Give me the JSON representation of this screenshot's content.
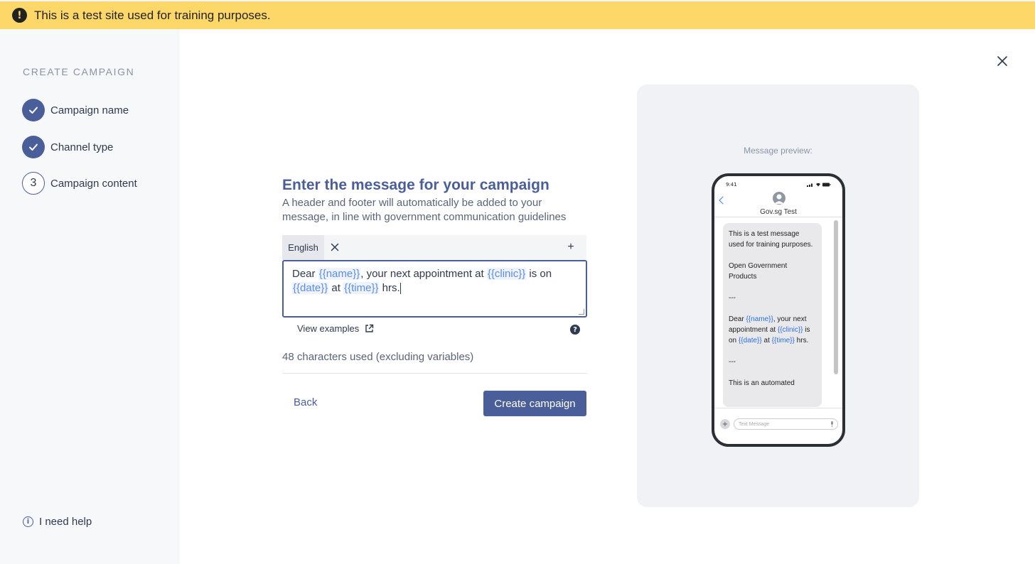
{
  "banner": {
    "text": "This is a test site used for training purposes.",
    "icon": "!"
  },
  "sidebar": {
    "title": "CREATE CAMPAIGN",
    "steps": [
      {
        "label": "Campaign name",
        "status": "done"
      },
      {
        "label": "Channel type",
        "status": "done"
      },
      {
        "label": "Campaign content",
        "status": "current",
        "number": "3"
      }
    ],
    "help_label": "I need help",
    "help_icon": "i"
  },
  "main": {
    "heading": "Enter the message for your campaign",
    "subtext": "A header and footer will automatically be added to your message, in line with government communication guidelines",
    "tabs": [
      {
        "label": "English",
        "active": true
      }
    ],
    "add_tab": "+",
    "message": {
      "dear": "Dear ",
      "name_var": "{{name}}",
      "part2": ", your next appointment at ",
      "clinic_var": "{{clinic}}",
      "part3": " is on",
      "date_var": "{{date}}",
      "at": " at ",
      "time_var": "{{time}}",
      "end": " hrs."
    },
    "view_examples": "View examples",
    "help_qmark": "?",
    "char_count": "48 characters used (excluding variables)",
    "back_label": "Back",
    "create_label": "Create campaign"
  },
  "preview": {
    "label": "Message preview:",
    "status_time": "9:41",
    "contact": "Gov.sg Test",
    "bubble_lines": {
      "header1": "This is a test message used for training purposes.",
      "header2": "Open Government Products",
      "sep": "---",
      "dear": "Dear ",
      "name_var": "{{name}}",
      "part2": ", your next appointment at ",
      "clinic_var": "{{clinic}}",
      "part3": " is on ",
      "date_var": "{{date}}",
      "at": " at ",
      "time_var": "{{time}}",
      "end": " hrs.",
      "footer": "This is an automated"
    },
    "input_placeholder": "Text Message"
  },
  "colors": {
    "primary": "#4a5f99",
    "banner": "#fdd869",
    "variable": "#5b8def"
  }
}
